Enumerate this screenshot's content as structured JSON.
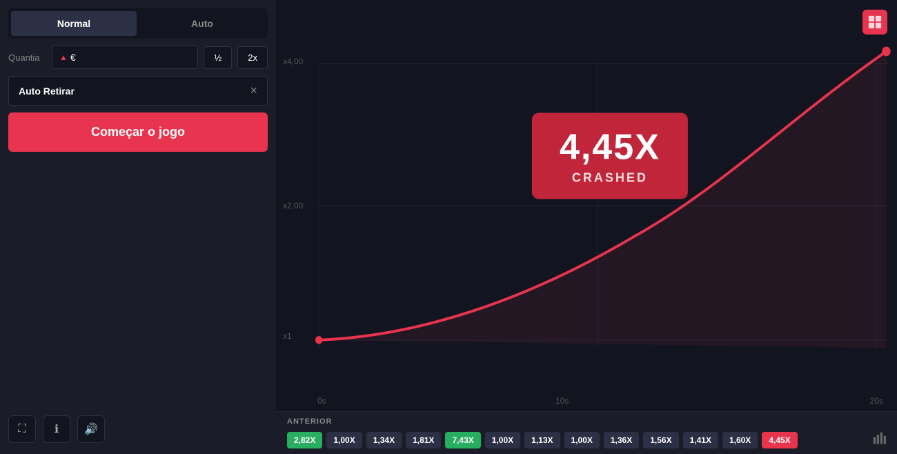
{
  "leftPanel": {
    "modeTabs": [
      {
        "label": "Normal",
        "active": true
      },
      {
        "label": "Auto",
        "active": false
      }
    ],
    "quantiaLabel": "Quantia",
    "quantiaValue": "",
    "currencySymbol": "€",
    "halfLabel": "½",
    "doubleLabel": "2x",
    "autoRetirarLabel": "Auto Retirar",
    "closeSymbol": "×",
    "startButtonLabel": "Começar o jogo"
  },
  "chart": {
    "crashMultiplier": "4,45X",
    "crashedLabel": "CRASHED",
    "yLabels": [
      "x4,00",
      "x2,00",
      "x1"
    ],
    "xLabels": [
      "0s",
      "10s",
      "20s"
    ]
  },
  "previousBar": {
    "label": "ANTERIOR",
    "items": [
      {
        "value": "2,82X",
        "type": "green"
      },
      {
        "value": "1,00X",
        "type": "normal"
      },
      {
        "value": "1,34X",
        "type": "normal"
      },
      {
        "value": "1,81X",
        "type": "normal"
      },
      {
        "value": "7,43X",
        "type": "green"
      },
      {
        "value": "1,00X",
        "type": "normal"
      },
      {
        "value": "1,13X",
        "type": "normal"
      },
      {
        "value": "1,00X",
        "type": "normal"
      },
      {
        "value": "1,36X",
        "type": "normal"
      },
      {
        "value": "1,56X",
        "type": "normal"
      },
      {
        "value": "1,41X",
        "type": "normal"
      },
      {
        "value": "1,60X",
        "type": "normal"
      },
      {
        "value": "4,45X",
        "type": "red-last"
      }
    ]
  },
  "bottomIcons": {
    "fullscreenIcon": "⛶",
    "infoIcon": "ℹ",
    "soundIcon": "🔊",
    "barchartIcon": "▐"
  }
}
